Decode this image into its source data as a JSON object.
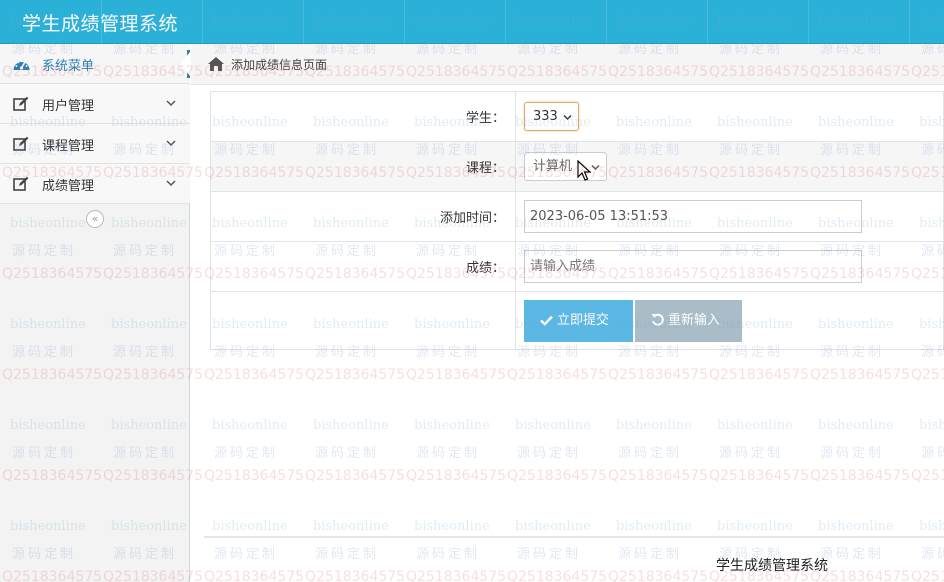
{
  "header": {
    "title": "学生成绩管理系统"
  },
  "sidebar": {
    "menu_title": "系统菜单",
    "items": [
      {
        "label": "用户管理"
      },
      {
        "label": "课程管理"
      },
      {
        "label": "成绩管理"
      }
    ],
    "collapse_glyph": "«"
  },
  "breadcrumb": {
    "text": "添加成绩信息页面"
  },
  "form": {
    "student_label": "学生：",
    "student_value": "333",
    "course_label": "课程：",
    "course_value": "计算机",
    "time_label": "添加时间：",
    "time_value": "2023-06-05 13:51:53",
    "score_label": "成绩：",
    "score_placeholder": "请输入成绩",
    "submit_label": "立即提交",
    "reset_label": "重新输入"
  },
  "footer": {
    "text": "学生成绩管理系统"
  },
  "watermark": {
    "line1": "bisheonline",
    "line2": "源码定制",
    "line3": "Q2518364575"
  },
  "colors": {
    "header_bg": "#2bb0d8",
    "accent": "#2a80b9",
    "submit_bg": "#5bb7e4",
    "reset_bg": "#a9bcc8"
  }
}
